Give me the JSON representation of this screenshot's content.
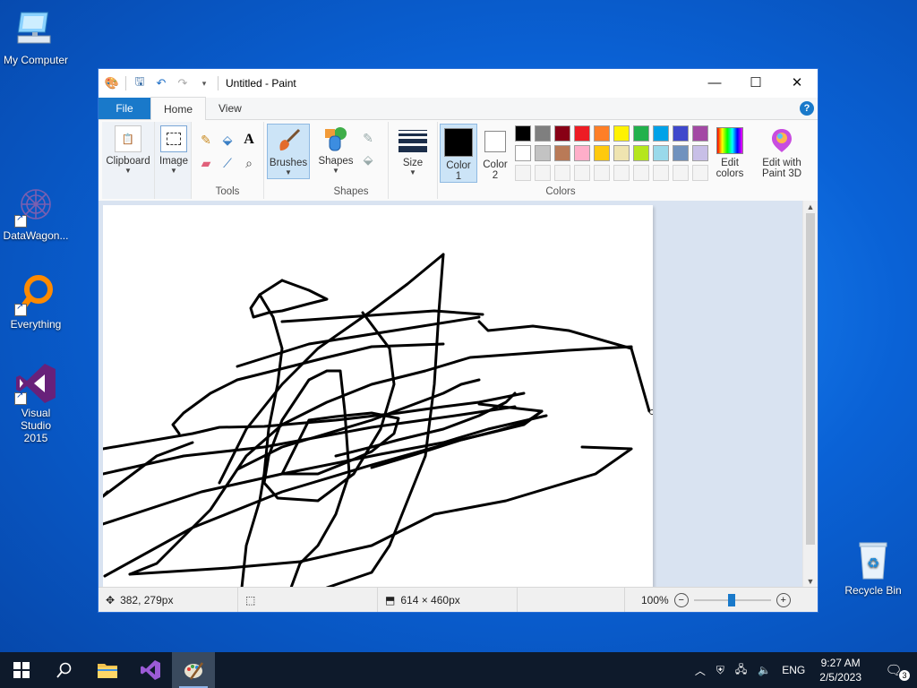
{
  "desktop": {
    "icons": [
      {
        "label": "My Computer"
      },
      {
        "label": "DataWagon..."
      },
      {
        "label": "Everything"
      },
      {
        "label": "Visual Studio 2015"
      },
      {
        "label": "Recycle Bin"
      }
    ]
  },
  "window": {
    "title": "Untitled - Paint",
    "tabs": [
      {
        "label": "File"
      },
      {
        "label": "Home"
      },
      {
        "label": "View"
      }
    ],
    "ribbon": {
      "clipboard": "Clipboard",
      "image": "Image",
      "tools": "Tools",
      "brushes": "Brushes",
      "shapes": "Shapes",
      "shapes_group": "Shapes",
      "size": "Size",
      "color1_a": "Color",
      "color1_b": "1",
      "color2_a": "Color",
      "color2_b": "2",
      "edit_colors_a": "Edit",
      "edit_colors_b": "colors",
      "paint3d_a": "Edit with",
      "paint3d_b": "Paint 3D",
      "colors_group": "Colors",
      "color1_value": "#000000",
      "color2_value": "#ffffff",
      "palette_row1": [
        "#000000",
        "#7f7f7f",
        "#880015",
        "#ed1c24",
        "#ff7f27",
        "#fff200",
        "#22b14c",
        "#00a2e8",
        "#3f48cc",
        "#a349a4"
      ],
      "palette_row2": [
        "#ffffff",
        "#c3c3c3",
        "#b97a57",
        "#ffaec9",
        "#ffc90e",
        "#efe4b0",
        "#b5e61d",
        "#99d9ea",
        "#7092be",
        "#c8bfe7"
      ]
    },
    "status": {
      "cursor_pos": "382, 279px",
      "image_size": "614 × 460px",
      "zoom": "100%"
    }
  },
  "taskbar": {
    "lang": "ENG",
    "time": "9:27 AM",
    "date": "2/5/2023",
    "notification_count": "3"
  }
}
